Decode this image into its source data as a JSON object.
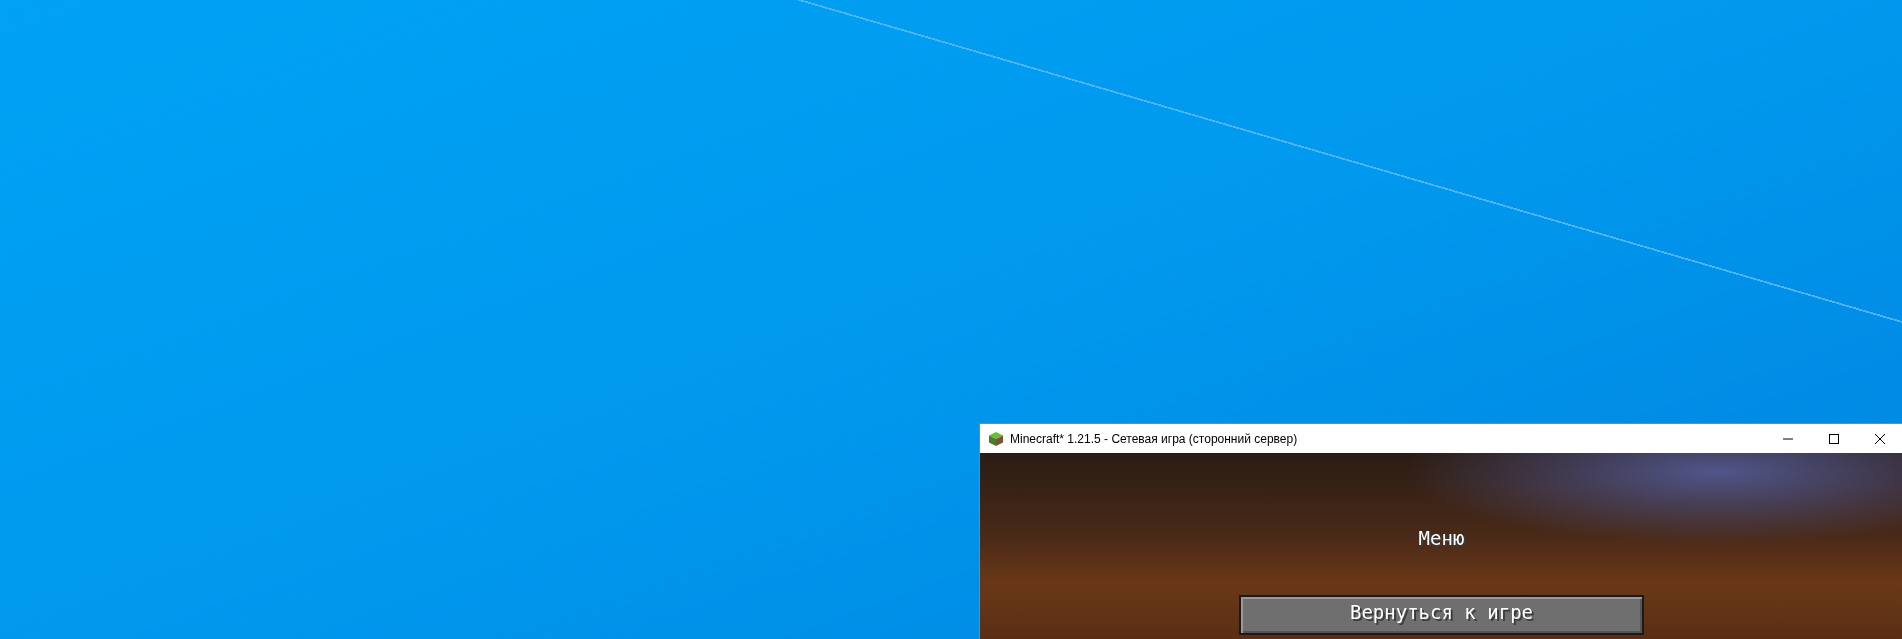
{
  "window": {
    "title": "Minecraft* 1.21.5 - Сетевая игра (сторонний сервер)"
  },
  "game": {
    "heading": "Меню",
    "buttons": [
      {
        "label": "Вернуться к игре"
      }
    ]
  }
}
